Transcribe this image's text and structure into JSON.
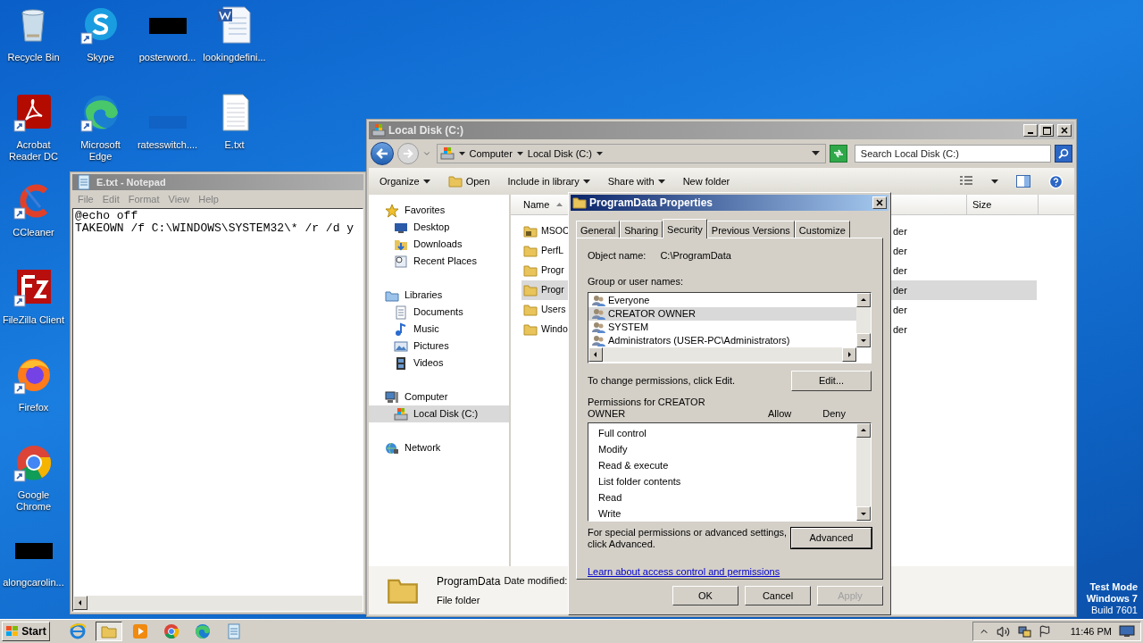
{
  "desktop": {
    "columns": [
      {
        "icons": [
          {
            "label": "Recycle Bin",
            "kind": "recycle",
            "shortcut": false
          },
          {
            "label": "Acrobat Reader DC",
            "kind": "acrobat",
            "shortcut": true
          },
          {
            "label": "CCleaner",
            "kind": "ccleaner",
            "shortcut": true
          },
          {
            "label": "FileZilla Client",
            "kind": "filezilla",
            "shortcut": true
          },
          {
            "label": "Firefox",
            "kind": "firefox",
            "shortcut": true
          },
          {
            "label": "Google Chrome",
            "kind": "chrome",
            "shortcut": true
          },
          {
            "label": "alongcarolin...",
            "kind": "redacted",
            "shortcut": false
          }
        ]
      },
      {
        "icons": [
          {
            "label": "Skype",
            "kind": "skype",
            "shortcut": true
          },
          {
            "label": "Microsoft Edge",
            "kind": "edge",
            "shortcut": true
          }
        ]
      },
      {
        "icons": [
          {
            "label": "posterword...",
            "kind": "redacted",
            "shortcut": false
          },
          {
            "label": "ratesswitch....",
            "kind": "bluefile",
            "shortcut": false
          }
        ]
      },
      {
        "icons": [
          {
            "label": "lookingdefini...",
            "kind": "word",
            "shortcut": false
          },
          {
            "label": "E.txt",
            "kind": "text",
            "shortcut": false
          }
        ]
      }
    ],
    "test_mode_notice": [
      "Test Mode",
      "Windows 7",
      "Build 7601"
    ]
  },
  "notepad": {
    "title": "E.txt - Notepad",
    "active": false,
    "menu": [
      "File",
      "Edit",
      "Format",
      "View",
      "Help"
    ],
    "lines": [
      "@echo off",
      "TAKEOWN /f C:\\WINDOWS\\SYSTEM32\\* /r /d y"
    ]
  },
  "explorer": {
    "title": "Local Disk (C:)",
    "active": false,
    "breadcrumb": [
      "Computer",
      "Local Disk (C:)"
    ],
    "search": {
      "placeholder": "Search Local Disk (C:)"
    },
    "toolbar": [
      {
        "label": "Organize",
        "kind": "menu"
      },
      {
        "label": "Open",
        "kind": "open"
      },
      {
        "label": "Include in library",
        "kind": "menu"
      },
      {
        "label": "Share with",
        "kind": "menu"
      },
      {
        "label": "New folder",
        "kind": "plain"
      }
    ],
    "nav": [
      {
        "label": "Favorites",
        "kind": "star",
        "selected": false,
        "children": [
          {
            "label": "Desktop",
            "kind": "desktop",
            "selected": false
          },
          {
            "label": "Downloads",
            "kind": "downloads",
            "selected": false
          },
          {
            "label": "Recent Places",
            "kind": "recent",
            "selected": false
          }
        ]
      },
      {
        "label": "Libraries",
        "kind": "libraries",
        "selected": false,
        "children": [
          {
            "label": "Documents",
            "kind": "documents",
            "selected": false
          },
          {
            "label": "Music",
            "kind": "music",
            "selected": false
          },
          {
            "label": "Pictures",
            "kind": "pictures",
            "selected": false
          },
          {
            "label": "Videos",
            "kind": "videos",
            "selected": false
          }
        ]
      },
      {
        "label": "Computer",
        "kind": "computer",
        "selected": false,
        "children": [
          {
            "label": "Local Disk (C:)",
            "kind": "disk",
            "selected": true
          }
        ]
      },
      {
        "label": "Network",
        "kind": "network",
        "selected": false
      }
    ],
    "columns": [
      "Name",
      "Size"
    ],
    "rows": [
      {
        "name": "MSOC",
        "type": "der",
        "locked": true,
        "selected": false
      },
      {
        "name": "PerfL",
        "type": "der",
        "locked": false,
        "selected": false
      },
      {
        "name": "Progr",
        "type": "der",
        "locked": false,
        "selected": false
      },
      {
        "name": "Progr",
        "type": "der",
        "locked": false,
        "selected": true
      },
      {
        "name": "Users",
        "type": "der",
        "locked": false,
        "selected": false
      },
      {
        "name": "Windo",
        "type": "der",
        "locked": false,
        "selected": false
      }
    ],
    "details": {
      "name": "ProgramData",
      "date_label": "Date modified:",
      "type": "File folder"
    }
  },
  "dialog": {
    "title": "ProgramData Properties",
    "tabs": [
      {
        "label": "General",
        "selected": false
      },
      {
        "label": "Sharing",
        "selected": false
      },
      {
        "label": "Security",
        "selected": true
      },
      {
        "label": "Previous Versions",
        "selected": false
      },
      {
        "label": "Customize",
        "selected": false
      }
    ],
    "object_label": "Object name:",
    "object_value": "C:\\ProgramData",
    "group_label": "Group or user names:",
    "users": [
      {
        "name": "Everyone",
        "selected": false
      },
      {
        "name": "CREATOR OWNER",
        "selected": true
      },
      {
        "name": "SYSTEM",
        "selected": false
      },
      {
        "name": "Administrators (USER-PC\\Administrators)",
        "selected": false
      }
    ],
    "edit_hint": "To change permissions, click Edit.",
    "edit_button": "Edit...",
    "permissions_label": "Permissions for CREATOR OWNER",
    "allow_label": "Allow",
    "deny_label": "Deny",
    "permissions": [
      "Full control",
      "Modify",
      "Read & execute",
      "List folder contents",
      "Read",
      "Write"
    ],
    "advanced_hint": "For special permissions or advanced settings, click Advanced.",
    "advanced_button": "Advanced",
    "link": "Learn about access control and permissions",
    "buttons": [
      {
        "label": "OK",
        "disabled": false
      },
      {
        "label": "Cancel",
        "disabled": false
      },
      {
        "label": "Apply",
        "disabled": true
      }
    ]
  },
  "taskbar": {
    "start": "Start",
    "apps": [
      {
        "kind": "ie",
        "active": false
      },
      {
        "kind": "explorer",
        "active": true
      },
      {
        "kind": "media",
        "active": false
      },
      {
        "kind": "chrome",
        "active": false
      },
      {
        "kind": "edge",
        "active": false
      },
      {
        "kind": "notepad",
        "active": false
      }
    ],
    "clock": "11:46 PM"
  }
}
